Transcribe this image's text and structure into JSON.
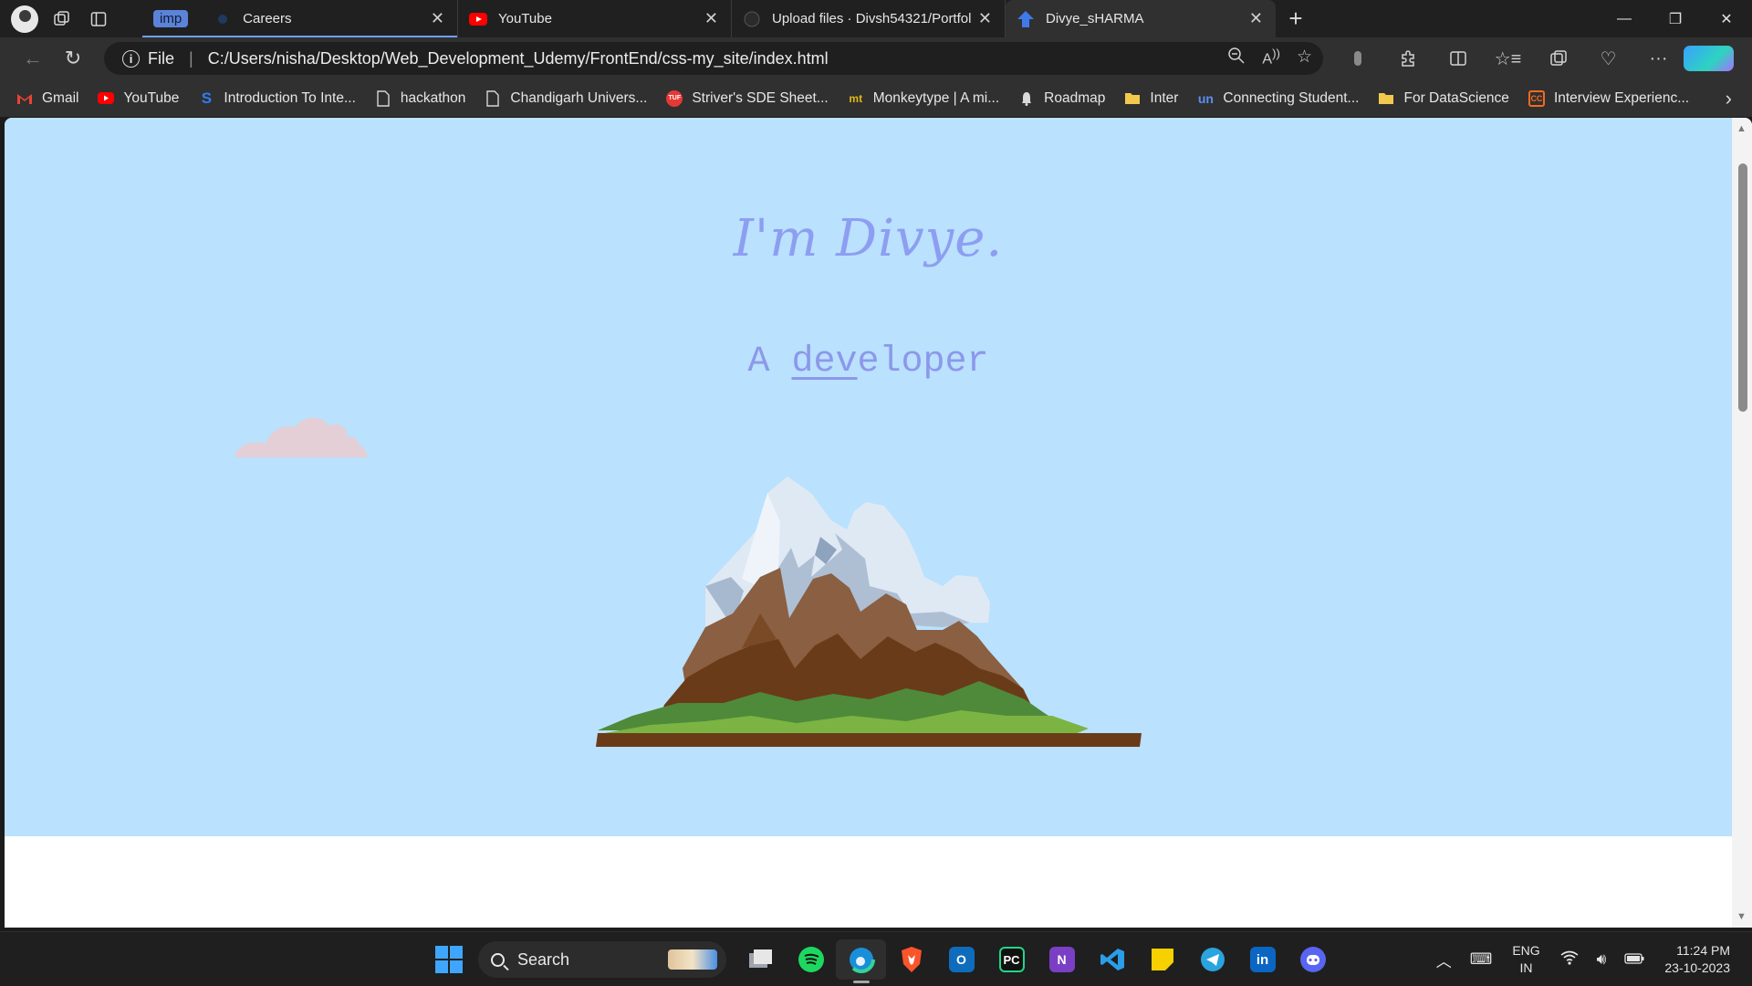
{
  "browser": {
    "tab_group_label": "imp",
    "tabs": [
      {
        "title": "Careers",
        "favicon": "careers-icon",
        "active": false
      },
      {
        "title": "YouTube",
        "favicon": "youtube-icon",
        "active": false
      },
      {
        "title": "Upload files · Divsh54321/Portfol",
        "favicon": "github-icon",
        "active": false
      },
      {
        "title": "Divye_sHARMA",
        "favicon": "site-icon",
        "active": true
      }
    ],
    "address": {
      "scheme_label": "File",
      "url": "C:/Users/nisha/Desktop/Web_Development_Udemy/FrontEnd/css-my_site/index.html"
    },
    "bookmarks": [
      {
        "label": "Gmail",
        "icon": "gmail-icon",
        "color": "#ea4335"
      },
      {
        "label": "YouTube",
        "icon": "youtube-icon",
        "color": "#ff0000"
      },
      {
        "label": "Introduction To Inte...",
        "icon": "s-icon",
        "color": "#2f7cf6"
      },
      {
        "label": "hackathon",
        "icon": "page-icon",
        "color": "#d6d6d6"
      },
      {
        "label": "Chandigarh Univers...",
        "icon": "page-icon",
        "color": "#d6d6d6"
      },
      {
        "label": "Striver's SDE Sheet...",
        "icon": "tuf-icon",
        "color": "#e53935"
      },
      {
        "label": "Monkeytype | A mi...",
        "icon": "mt-icon",
        "color": "#e2b714"
      },
      {
        "label": "Roadmap",
        "icon": "bell-icon",
        "color": "#cccccc"
      },
      {
        "label": "Inter",
        "icon": "folder-icon",
        "color": "#f2c94c"
      },
      {
        "label": "Connecting Student...",
        "icon": "un-icon",
        "color": "#2f6fd6"
      },
      {
        "label": "For DataScience",
        "icon": "folder-icon",
        "color": "#f2c94c"
      },
      {
        "label": "Interview Experienc...",
        "icon": "gfg-icon",
        "color": "#f36c21"
      }
    ]
  },
  "page": {
    "heading": "I'm Divye.",
    "subtitle_prefix": "A ",
    "subtitle_underlined": "dev",
    "subtitle_rest": "eloper",
    "background_color": "#bae1fd",
    "text_color": "#8d9ef2"
  },
  "taskbar": {
    "search_label": "Search",
    "apps": [
      "file-explorer-icon",
      "spotify-icon",
      "edge-icon",
      "brave-icon",
      "outlook-icon",
      "pycharm-icon",
      "onenote-icon",
      "vscode-icon",
      "sticky-notes-icon",
      "telegram-icon",
      "linkedin-icon",
      "discord-icon"
    ],
    "language_line1": "ENG",
    "language_line2": "IN",
    "time": "11:24 PM",
    "date": "23-10-2023"
  }
}
